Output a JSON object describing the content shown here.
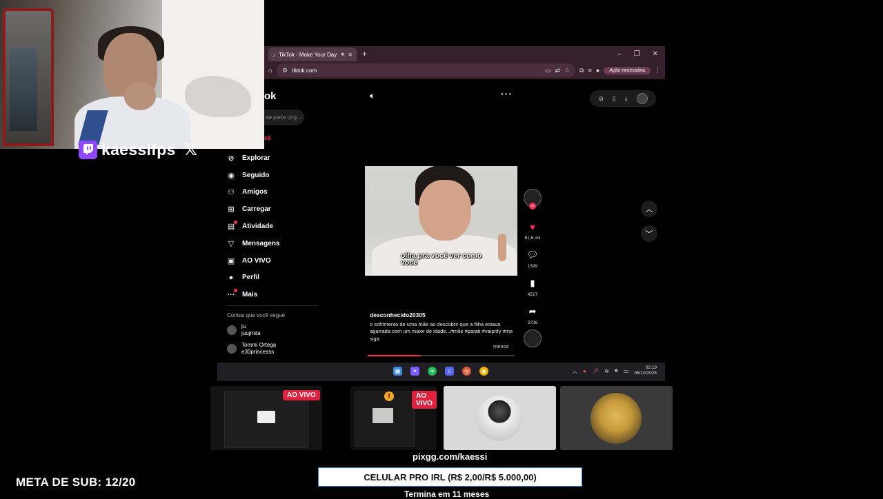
{
  "overlay": {
    "streamer": "kaessifps",
    "pix_link": "pixgg.com/kaessi",
    "goal_label": "CELULAR PRO IRL (R$ 2,00/R$ 5.000,00)",
    "goal_time": "Termina em 11 meses",
    "sub_goal": "META DE SUB: 12/20",
    "live_badge": "AO VIVO",
    "colors": {
      "twitch": "#9147ff",
      "live": "#e0213f"
    }
  },
  "browser": {
    "tab_title": "TikTok - Make Your Day",
    "url": "tiktok.com",
    "action_needed": "Ação necessária"
  },
  "tiktok": {
    "logo_fragment": "ok",
    "search_placeholder": "ae parte orig...",
    "for_you_fragment": "cê",
    "nav": [
      {
        "label": "Explorar",
        "icon": "compass-icon"
      },
      {
        "label": "Seguido",
        "icon": "following-icon"
      },
      {
        "label": "Amigos",
        "icon": "friends-icon"
      },
      {
        "label": "Carregar",
        "icon": "upload-icon"
      },
      {
        "label": "Atividade",
        "icon": "activity-icon"
      },
      {
        "label": "Mensagens",
        "icon": "messages-icon"
      },
      {
        "label": "AO VIVO",
        "icon": "live-icon"
      },
      {
        "label": "Perfil",
        "icon": "profile-icon"
      },
      {
        "label": "Mais",
        "icon": "more-icon"
      }
    ],
    "following_header": "Contas que você segue",
    "accounts": [
      {
        "name": "ju",
        "handle": "juujmita"
      },
      {
        "name": "Tommi Ortega",
        "handle": "e30princesss"
      }
    ],
    "video": {
      "caption": "olha pra você ver como você",
      "author": "desconhecido20305",
      "description": "o sofrimento de uma mãe ao descobrir que a filha estava agarrada com um maior de idade...#mãe  #parati #vaiprify  #me siga",
      "less": "menos",
      "progress": 0.36,
      "likes": "61,6 mil",
      "comments": "1599",
      "saves": "4527",
      "shares": "2736"
    }
  },
  "taskbar": {
    "time": "02:19",
    "date": "06/10/2025"
  },
  "colors": {
    "accent": "#fe2c55",
    "browser_chrome": "#35202c"
  }
}
